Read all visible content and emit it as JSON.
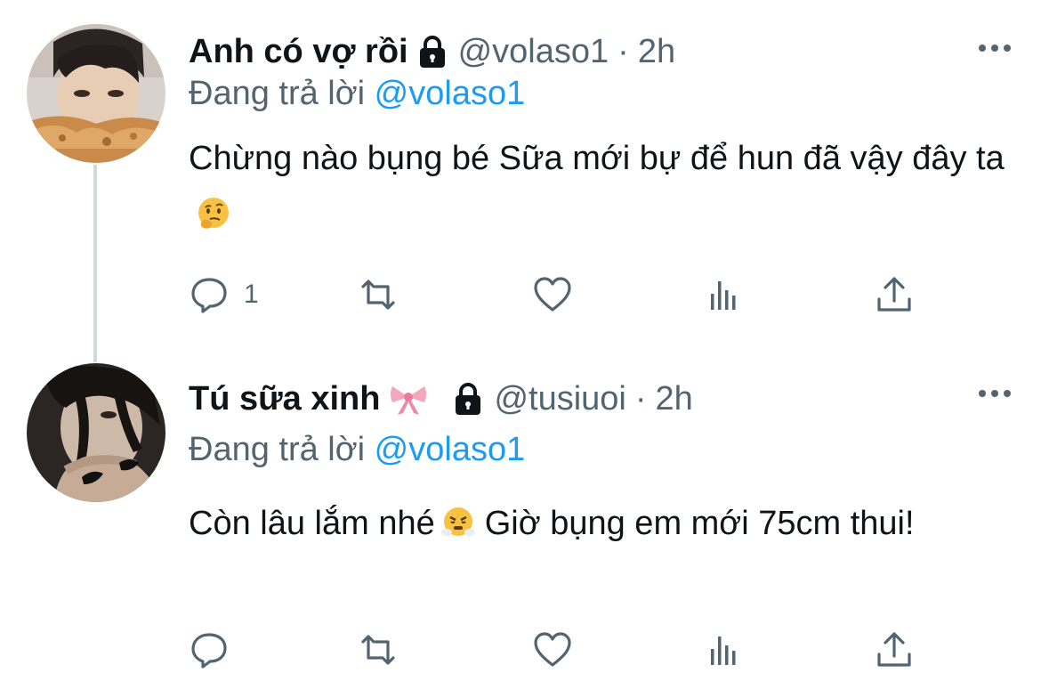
{
  "colors": {
    "text_primary": "#0f1419",
    "text_secondary": "#536471",
    "link": "#1d9bf0",
    "thread_line": "#cfd9de"
  },
  "tweets": [
    {
      "display_name": "Anh có vợ rồi",
      "handle": "@volaso1",
      "separator": "·",
      "time": "2h",
      "replying_prefix": "Đang trả lời",
      "replying_to": "@volaso1",
      "text_before_emoji": "Chừng nào bụng bé Sữa mới bự để hun đã vậy đây ta",
      "emoji": "thinking-face",
      "reply_count": "1",
      "protected_icon": "lock-icon"
    },
    {
      "display_name": "Tú sữa xinh",
      "name_emoji": "ribbon",
      "handle": "@tusiuoi",
      "separator": "·",
      "time": "2h",
      "replying_prefix": "Đang trả lời",
      "replying_to": "@volaso1",
      "text_before_emoji": "Còn lâu lắm nhé",
      "emoji": "face-with-steam",
      "text_after_emoji": "Giờ bụng em mới 75cm thui!",
      "reply_count": "",
      "protected_icon": "lock-icon"
    }
  ]
}
